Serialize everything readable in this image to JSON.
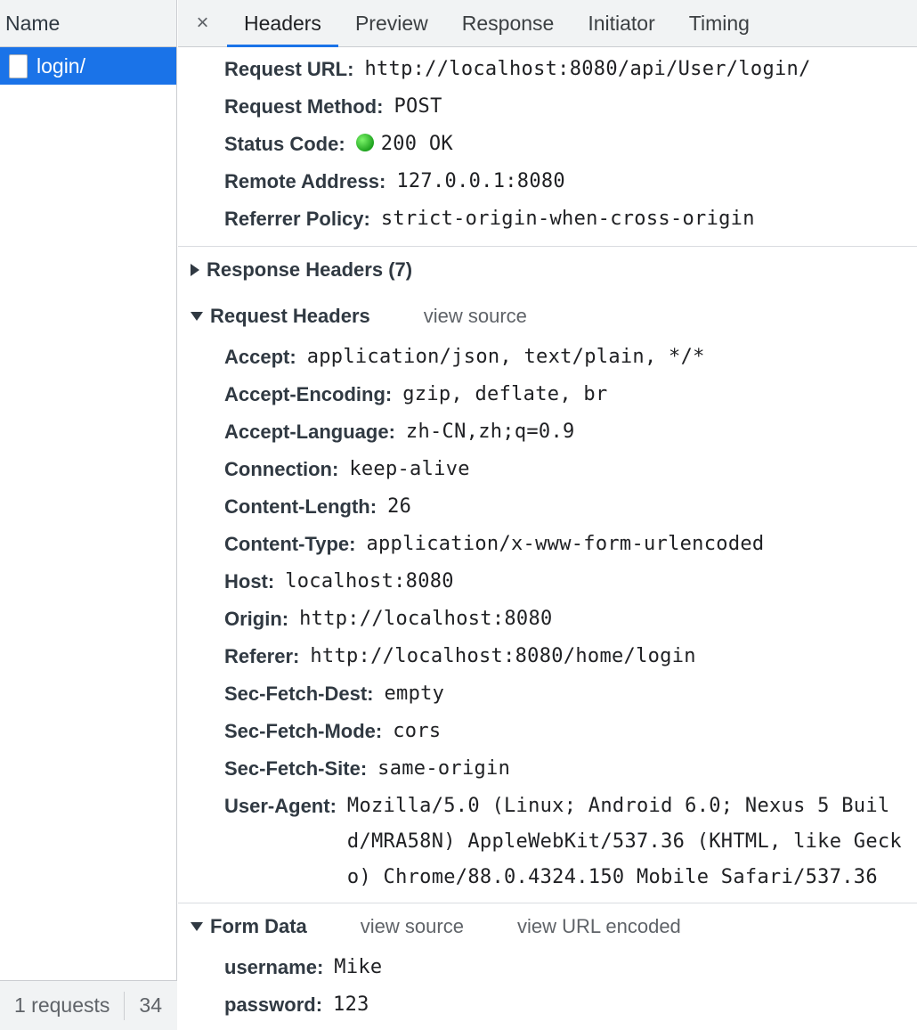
{
  "left": {
    "header": "Name",
    "rows": [
      {
        "label": "login/"
      }
    ],
    "footer": {
      "count": "1 requests",
      "size": "34"
    }
  },
  "tabs": {
    "close": "×",
    "items": [
      "Headers",
      "Preview",
      "Response",
      "Initiator",
      "Timing"
    ],
    "active": "Headers"
  },
  "general": [
    {
      "key": "Request URL:",
      "value": "http://localhost:8080/api/User/login/"
    },
    {
      "key": "Request Method:",
      "value": "POST"
    },
    {
      "key": "Status Code:",
      "value": "200 OK"
    },
    {
      "key": "Remote Address:",
      "value": "127.0.0.1:8080"
    },
    {
      "key": "Referrer Policy:",
      "value": "strict-origin-when-cross-origin"
    }
  ],
  "response_headers": {
    "title": "Response Headers (7)"
  },
  "request_headers": {
    "title": "Request Headers",
    "view_source": "view source",
    "items": [
      {
        "key": "Accept:",
        "value": "application/json, text/plain, */*"
      },
      {
        "key": "Accept-Encoding:",
        "value": "gzip, deflate, br"
      },
      {
        "key": "Accept-Language:",
        "value": "zh-CN,zh;q=0.9"
      },
      {
        "key": "Connection:",
        "value": "keep-alive"
      },
      {
        "key": "Content-Length:",
        "value": "26"
      },
      {
        "key": "Content-Type:",
        "value": "application/x-www-form-urlencoded"
      },
      {
        "key": "Host:",
        "value": "localhost:8080"
      },
      {
        "key": "Origin:",
        "value": "http://localhost:8080"
      },
      {
        "key": "Referer:",
        "value": "http://localhost:8080/home/login"
      },
      {
        "key": "Sec-Fetch-Dest:",
        "value": "empty"
      },
      {
        "key": "Sec-Fetch-Mode:",
        "value": "cors"
      },
      {
        "key": "Sec-Fetch-Site:",
        "value": "same-origin"
      },
      {
        "key": "User-Agent:",
        "value": "Mozilla/5.0 (Linux; Android 6.0; Nexus 5 Build/MRA58N) AppleWebKit/537.36 (KHTML, like Gecko) Chrome/88.0.4324.150 Mobile Safari/537.36"
      }
    ]
  },
  "form_data": {
    "title": "Form Data",
    "view_source": "view source",
    "view_url_encoded": "view URL encoded",
    "items": [
      {
        "key": "username:",
        "value": "Mike"
      },
      {
        "key": "password:",
        "value": "123"
      }
    ]
  },
  "colors": {
    "accent": "#1a73e8",
    "status_ok": "#1fa31f"
  }
}
